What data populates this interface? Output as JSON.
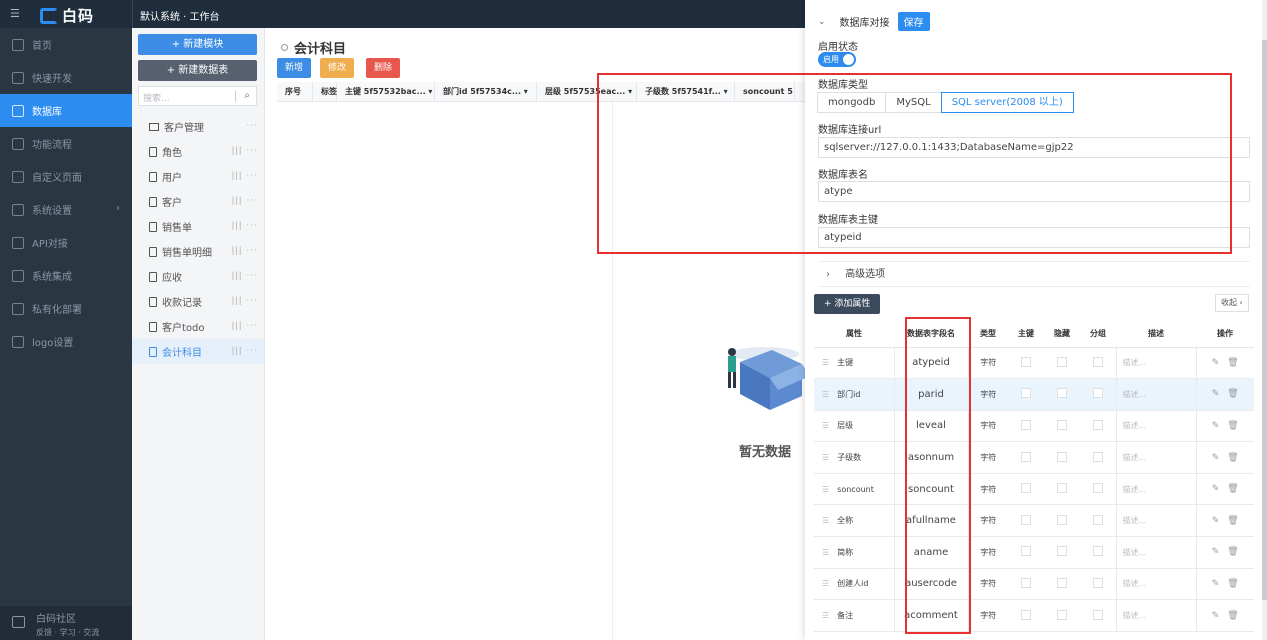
{
  "app": {
    "logo_text": "白码",
    "breadcrumb": "默认系统 · 工作台"
  },
  "nav": [
    {
      "label": "首页",
      "icon": "home-icon"
    },
    {
      "label": "快速开发",
      "icon": "rocket-icon"
    },
    {
      "label": "数据库",
      "icon": "database-icon",
      "active": true
    },
    {
      "label": "功能流程",
      "icon": "flow-icon"
    },
    {
      "label": "自定义页面",
      "icon": "page-icon"
    },
    {
      "label": "系统设置",
      "icon": "settings-icon",
      "arrow": "›"
    },
    {
      "label": "API对接",
      "icon": "api-icon"
    },
    {
      "label": "系统集成",
      "icon": "integration-icon"
    },
    {
      "label": "私有化部署",
      "icon": "deploy-icon"
    },
    {
      "label": "logo设置",
      "icon": "logo-icon"
    }
  ],
  "community": {
    "title": "白码社区",
    "subtitle": "反馈 · 学习 · 交流"
  },
  "modules": {
    "new_module": "+ 新建模块",
    "new_table": "+ 新建数据表",
    "search_placeholder": "搜索...",
    "items": [
      {
        "label": "客户管理",
        "type": "folder"
      },
      {
        "label": "角色",
        "type": "table"
      },
      {
        "label": "用户",
        "type": "table"
      },
      {
        "label": "客户",
        "type": "table"
      },
      {
        "label": "销售单",
        "type": "table"
      },
      {
        "label": "销售单明细",
        "type": "table"
      },
      {
        "label": "应收",
        "type": "table"
      },
      {
        "label": "收款记录",
        "type": "table"
      },
      {
        "label": "客户todo",
        "type": "table"
      },
      {
        "label": "会计科目",
        "type": "table",
        "active": true
      }
    ]
  },
  "workspace": {
    "title": "会计科目",
    "buttons": {
      "add": "新增",
      "edit": "修改",
      "delete": "删除"
    },
    "columns": [
      "序号",
      "标签",
      "主键 5f57532bac... ▾",
      "部门id 5f57534c... ▾",
      "层级 5f57535eac... ▾",
      "子级数 5f57541f... ▾",
      "soncount 5"
    ],
    "empty_text": "暂无数据"
  },
  "drawer": {
    "section_title": "数据库对接",
    "save": "保存",
    "status_label": "启用状态",
    "status_toggle": "启用",
    "db_type_label": "数据库类型",
    "db_types": [
      "mongodb",
      "MySQL",
      "SQL server(2008 以上)"
    ],
    "db_type_selected": "SQL server(2008 以上)",
    "url_label": "数据库连接url",
    "url_value": "sqlserver://127.0.0.1:1433;DatabaseName=gjp22",
    "table_label": "数据库表名",
    "table_value": "atype",
    "pk_label": "数据库表主键",
    "pk_value": "atypeid",
    "advanced": "高级选项",
    "add_attr": "+ 添加属性",
    "collapse": "收起 ‹",
    "table_headers": [
      "属性",
      "数据表字段名",
      "类型",
      "主键",
      "隐藏",
      "分组",
      "描述",
      "操作"
    ],
    "rows": [
      {
        "name": "主键",
        "field": "atypeid",
        "type": "字符",
        "desc": "描述..."
      },
      {
        "name": "部门id",
        "field": "parid",
        "type": "字符",
        "desc": "描述...",
        "hl": true
      },
      {
        "name": "层级",
        "field": "leveal",
        "type": "字符",
        "desc": "描述..."
      },
      {
        "name": "子级数",
        "field": "asonnum",
        "type": "字符",
        "desc": "描述..."
      },
      {
        "name": "soncount",
        "field": "soncount",
        "type": "字符",
        "desc": "描述..."
      },
      {
        "name": "全称",
        "field": "afullname",
        "type": "字符",
        "desc": "描述..."
      },
      {
        "name": "简称",
        "field": "aname",
        "type": "字符",
        "desc": "描述..."
      },
      {
        "name": "创建人id",
        "field": "ausercode",
        "type": "字符",
        "desc": "描述..."
      },
      {
        "name": "备注",
        "field": "acomment",
        "type": "字符",
        "desc": "描述..."
      }
    ]
  },
  "colors": {
    "accent": "#2d8cf0",
    "sidebar": "#2b3643",
    "topbar": "#1f2d3d",
    "highlight": "#e83030",
    "edit": "#f0ad4e",
    "delete": "#e8574e",
    "add": "#3d8de6"
  }
}
